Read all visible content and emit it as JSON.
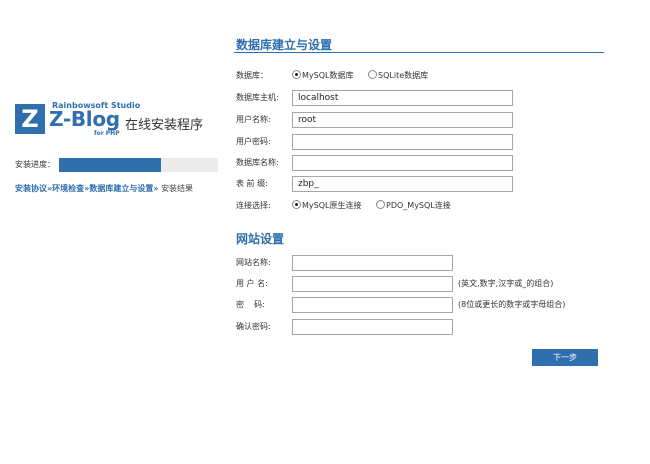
{
  "logo": {
    "letter": "Z",
    "studio": "Rainbowsoft Studio",
    "brand": "Z-Blog",
    "platform": "for PHP",
    "installer_title": "在线安装程序"
  },
  "progress": {
    "label": "安装进度：",
    "fraction": 0.64,
    "fill_color": "#2f6fae"
  },
  "steps": [
    {
      "label": "安装协议",
      "state": "done"
    },
    {
      "label": "环境检查",
      "state": "done"
    },
    {
      "label": "数据库建立与设置",
      "state": "current"
    },
    {
      "label": "安装结果",
      "state": "todo"
    }
  ],
  "step_separator": "»",
  "db_section": {
    "title": "数据库建立与设置",
    "db_type": {
      "label": "数据库：",
      "options": [
        "MySQL数据库",
        "SQLite数据库"
      ],
      "selected": "MySQL数据库"
    },
    "host": {
      "label": "数据库主机:",
      "value": "localhost"
    },
    "user": {
      "label": "用户名称:",
      "value": "root"
    },
    "password": {
      "label": "用户密码:",
      "value": ""
    },
    "db_name": {
      "label": "数据库名称:",
      "value": ""
    },
    "prefix": {
      "label": "表 前 缀:",
      "value": "zbp_"
    },
    "connection": {
      "label": "连接选择:",
      "options": [
        "MySQL原生连接",
        "PDO_MySQL连接"
      ],
      "selected": "MySQL原生连接"
    }
  },
  "site_section": {
    "title": "网站设置",
    "site_name": {
      "label": "网站名称:",
      "value": ""
    },
    "admin_user": {
      "label": "用 户 名:",
      "value": "",
      "hint": "(英文,数字,汉字或_的组合)"
    },
    "admin_password": {
      "label": "密    码:",
      "value": "",
      "hint": "(8位或更长的数字或字母组合)"
    },
    "confirm_password": {
      "label": "确认密码:",
      "value": ""
    }
  },
  "next_button": {
    "label": "下一步"
  },
  "colors": {
    "accent": "#2f6fae",
    "input_border": "#a6a6a6"
  }
}
